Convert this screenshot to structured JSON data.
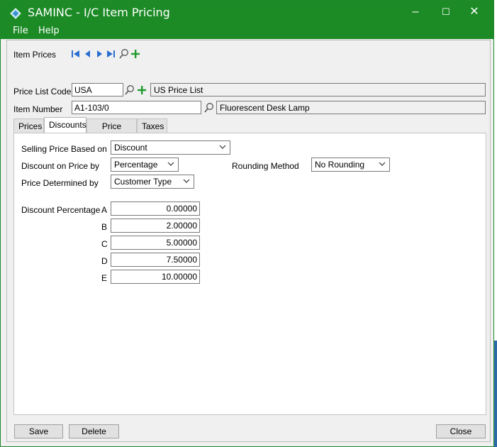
{
  "window": {
    "title": "SAMINC - I/C Item Pricing",
    "minimize": "–",
    "maximize": "☐",
    "close": "✕",
    "accent": "#1c8b26"
  },
  "menu": {
    "file": "File",
    "help": "Help"
  },
  "toolbar": {
    "label": "Item Prices",
    "icons": [
      "first-record-icon",
      "previous-record-icon",
      "next-record-icon",
      "last-record-icon",
      "lookup-icon",
      "add-icon"
    ]
  },
  "header": {
    "price_list_code_label": "Price List Code",
    "price_list_code_value": "USA",
    "price_list_desc": "US Price List",
    "item_number_label": "Item Number",
    "item_number_value": "A1-103/0",
    "item_desc": "Fluorescent Desk Lamp"
  },
  "tabs": [
    {
      "label": "Prices"
    },
    {
      "label": "Discounts"
    },
    {
      "label": "Price Check"
    },
    {
      "label": "Taxes"
    }
  ],
  "active_tab": "Discounts",
  "discounts": {
    "selling_price_based_on_label": "Selling Price Based on",
    "selling_price_based_on_value": "Discount",
    "discount_on_price_by_label": "Discount on Price by",
    "discount_on_price_by_value": "Percentage",
    "rounding_method_label": "Rounding Method",
    "rounding_method_value": "No Rounding",
    "price_determined_by_label": "Price Determined by",
    "price_determined_by_value": "Customer Type",
    "discount_percentage_label": "Discount Percentage",
    "rows": [
      {
        "letter": "A",
        "value": "0.00000"
      },
      {
        "letter": "B",
        "value": "2.00000"
      },
      {
        "letter": "C",
        "value": "5.00000"
      },
      {
        "letter": "D",
        "value": "7.50000"
      },
      {
        "letter": "E",
        "value": "10.00000"
      }
    ]
  },
  "buttons": {
    "save": "Save",
    "delete": "Delete",
    "close": "Close"
  }
}
